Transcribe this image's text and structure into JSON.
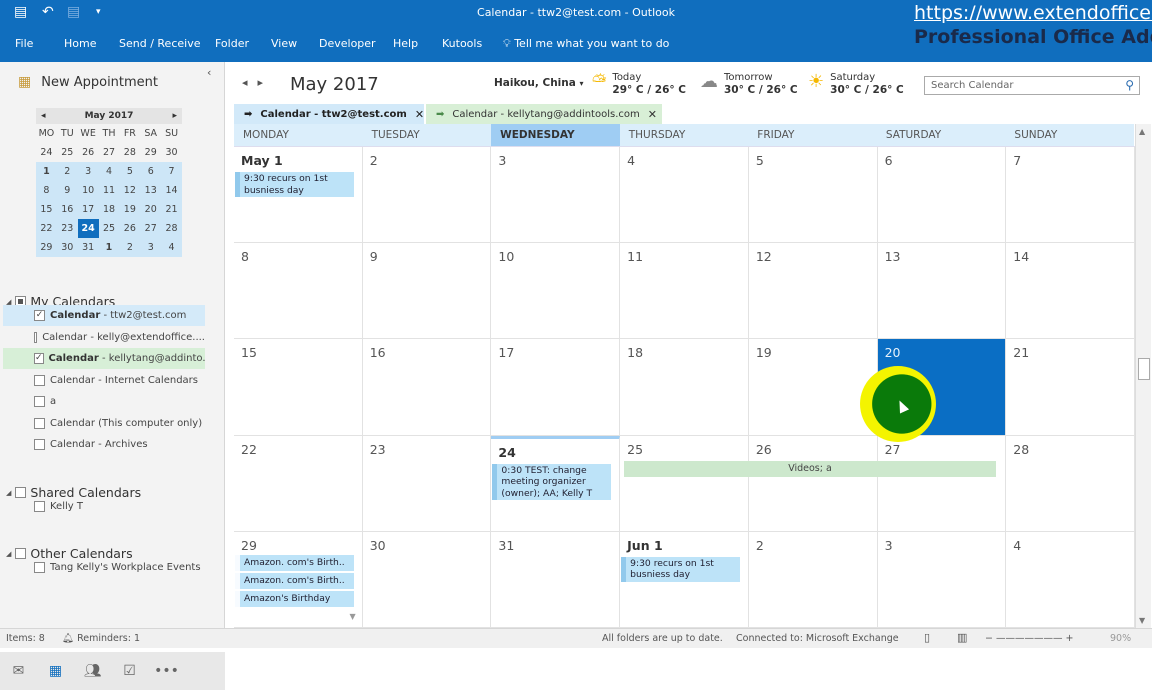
{
  "titlebar": {
    "title": "Calendar - ttw2@test.com  -  Outlook",
    "watermark_url": "https://www.extendoffice.com",
    "watermark_tag": "Professional Office Add-ins"
  },
  "ribbon": {
    "tabs": [
      "File",
      "Home",
      "Send / Receive",
      "Folder",
      "View",
      "Developer",
      "Help",
      "Kutools"
    ],
    "tell_me": "Tell me what you want to do"
  },
  "sidebar": {
    "new_appointment": "New Appointment",
    "mini_calendar": {
      "title": "May 2017",
      "dow": [
        "MO",
        "TU",
        "WE",
        "TH",
        "FR",
        "SA",
        "SU"
      ],
      "weeks": [
        [
          "24",
          "25",
          "26",
          "27",
          "28",
          "29",
          "30"
        ],
        [
          "1",
          "2",
          "3",
          "4",
          "5",
          "6",
          "7"
        ],
        [
          "8",
          "9",
          "10",
          "11",
          "12",
          "13",
          "14"
        ],
        [
          "15",
          "16",
          "17",
          "18",
          "19",
          "20",
          "21"
        ],
        [
          "22",
          "23",
          "24",
          "25",
          "26",
          "27",
          "28"
        ],
        [
          "29",
          "30",
          "31",
          "1",
          "2",
          "3",
          "4"
        ]
      ],
      "selected": "24"
    },
    "sections": [
      {
        "title": "My Calendars",
        "items": [
          {
            "bold": "Calendar",
            "rest": " - ttw2@test.com",
            "checked": true,
            "highlight": "blue"
          },
          {
            "bold": "",
            "rest": "Calendar - kelly@extendoffice....",
            "checked": false,
            "highlight": ""
          },
          {
            "bold": "Calendar",
            "rest": " - kellytang@addinto...",
            "checked": true,
            "highlight": "green"
          },
          {
            "bold": "",
            "rest": "Calendar - Internet Calendars",
            "checked": false,
            "highlight": ""
          },
          {
            "bold": "",
            "rest": "a",
            "checked": false,
            "highlight": ""
          },
          {
            "bold": "",
            "rest": "Calendar (This computer only)",
            "checked": false,
            "highlight": ""
          },
          {
            "bold": "",
            "rest": "Calendar - Archives",
            "checked": false,
            "highlight": ""
          }
        ]
      },
      {
        "title": "Shared Calendars",
        "items": [
          {
            "bold": "",
            "rest": "Kelly T",
            "checked": false,
            "highlight": ""
          }
        ]
      },
      {
        "title": "Other Calendars",
        "items": [
          {
            "bold": "",
            "rest": "Tang Kelly's Workplace Events",
            "checked": false,
            "highlight": ""
          }
        ]
      }
    ],
    "nav_icons": [
      "mail-icon",
      "calendar-icon",
      "people-icon",
      "tasks-icon",
      "more-icon"
    ]
  },
  "main": {
    "month_title": "May 2017",
    "location": "Haikou, China",
    "weather": [
      {
        "label": "Today",
        "temp": "29° C / 26° C",
        "icon": "partly-sunny"
      },
      {
        "label": "Tomorrow",
        "temp": "30° C / 26° C",
        "icon": "cloudy"
      },
      {
        "label": "Saturday",
        "temp": "30° C / 26° C",
        "icon": "sunny"
      }
    ],
    "search_placeholder": "Search Calendar",
    "calendar_tabs": [
      {
        "label": "Calendar - ttw2@test.com"
      },
      {
        "label": "Calendar - kellytang@addintools.com"
      }
    ],
    "day_headers": [
      "MONDAY",
      "TUESDAY",
      "WEDNESDAY",
      "THURSDAY",
      "FRIDAY",
      "SATURDAY",
      "SUNDAY"
    ],
    "weeks": [
      [
        {
          "n": "May 1",
          "bold": true,
          "events": [
            "9:30 recurs on 1st busniess day"
          ]
        },
        {
          "n": "2"
        },
        {
          "n": "3"
        },
        {
          "n": "4"
        },
        {
          "n": "5"
        },
        {
          "n": "6"
        },
        {
          "n": "7"
        }
      ],
      [
        {
          "n": "8"
        },
        {
          "n": "9"
        },
        {
          "n": "10"
        },
        {
          "n": "11"
        },
        {
          "n": "12"
        },
        {
          "n": "13"
        },
        {
          "n": "14"
        }
      ],
      [
        {
          "n": "15"
        },
        {
          "n": "16"
        },
        {
          "n": "17"
        },
        {
          "n": "18"
        },
        {
          "n": "19"
        },
        {
          "n": "20",
          "selected": true
        },
        {
          "n": "21"
        }
      ],
      [
        {
          "n": "22"
        },
        {
          "n": "23"
        },
        {
          "n": "24",
          "bold": true,
          "today": true,
          "events": [
            "0:30 TEST: change meeting organizer (owner); AA; Kelly T"
          ]
        },
        {
          "n": "25"
        },
        {
          "n": "26"
        },
        {
          "n": "27"
        },
        {
          "n": "28"
        }
      ],
      [
        {
          "n": "29",
          "small_events": [
            "Amazon. com's Birth..",
            "Amazon. com's Birth..",
            "Amazon's Birthday"
          ]
        },
        {
          "n": "30"
        },
        {
          "n": "31"
        },
        {
          "n": "Jun 1",
          "bold": true,
          "events": [
            "9:30 recurs on 1st busniess day"
          ]
        },
        {
          "n": "2"
        },
        {
          "n": "3"
        },
        {
          "n": "4"
        }
      ]
    ],
    "multi_day_event": "Videos; a"
  },
  "status": {
    "items": "Items: 8",
    "reminders": "Reminders: 1",
    "sync": "All folders are up to date.",
    "connection": "Connected to: Microsoft Exchange",
    "zoom": "90%"
  }
}
